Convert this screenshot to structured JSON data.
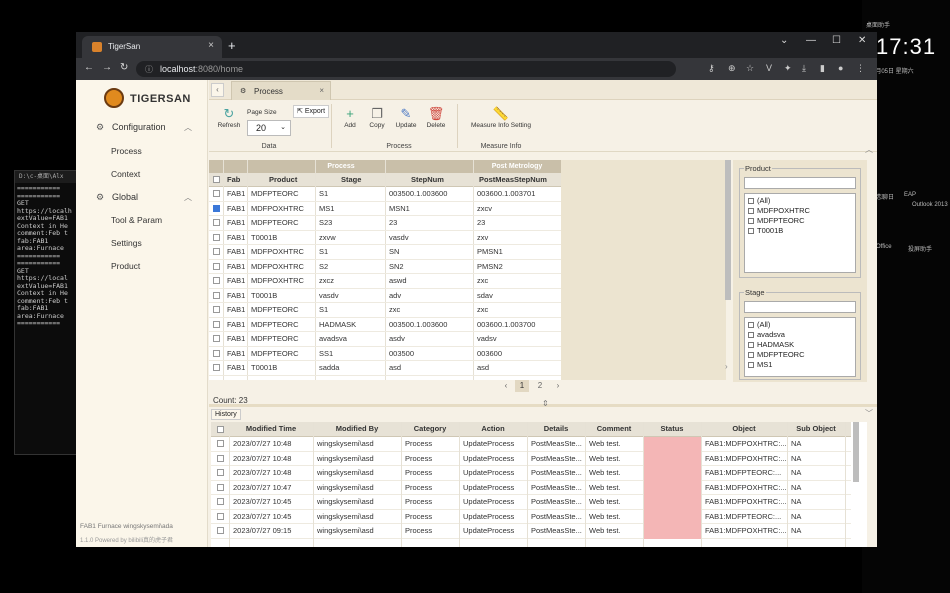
{
  "desktop": {
    "clock": "17:31",
    "widget_top": "桌面助手",
    "date_line": "7月05日  星期六",
    "icons": [
      "恋聊日",
      "EAP",
      "Outlook 2013",
      "Office",
      "投屏助手"
    ]
  },
  "console": {
    "title": "D:\\c-桌面\\Alx",
    "lines": [
      "===========",
      "",
      "===========",
      "GET",
      "https://localh",
      "extValue=FAB1",
      "",
      "Context in He",
      "comment:Feb t",
      "fab:FAB1",
      "area:Furnace",
      "",
      "===========",
      "",
      "===========",
      "GET",
      "https://local",
      "extValue=FAB1",
      "",
      "Context in He",
      "comment:Feb t",
      "fab:FAB1",
      "area:Furnace",
      "",
      "==========="
    ]
  },
  "browser": {
    "tab_title": "TigerSan",
    "url_host": "localhost",
    "url_path": ":8080/home"
  },
  "app": {
    "brand": "TIGERSAN",
    "nav": {
      "config_label": "Configuration",
      "config_items": [
        "Process",
        "Context"
      ],
      "global_label": "Global",
      "global_items": [
        "Tool & Param",
        "Settings",
        "Product"
      ]
    },
    "footer1": "FAB1  Furnace  wingskysemi\\ada",
    "footer2": "1.1.0  Powered by bilibili真的虎子君",
    "content_tab": "Process",
    "ribbon": {
      "refresh": "Refresh",
      "page_size_label": "Page Size",
      "page_size_value": "20",
      "export": "Export",
      "group_data": "Data",
      "add": "Add",
      "copy": "Copy",
      "update": "Update",
      "delete": "Delete",
      "group_process": "Process",
      "measure_setting": "Measure Info Setting",
      "group_measure": "Measure Info"
    },
    "grid": {
      "group_process": "Process",
      "group_post": "Post Metrology",
      "headers": [
        "Fab",
        "Product",
        "Stage",
        "StepNum",
        "PostMeasStepNum"
      ],
      "rows": [
        {
          "checked": false,
          "c": [
            "FAB1",
            "MDFPTEORC",
            "S1",
            "003500.1.003600",
            "003600.1.003701"
          ]
        },
        {
          "checked": true,
          "c": [
            "FAB1",
            "MDFPOXHTRC",
            "MS1",
            "MSN1",
            "zxcv"
          ]
        },
        {
          "checked": false,
          "c": [
            "FAB1",
            "MDFPTEORC",
            "S23",
            "23",
            "23"
          ]
        },
        {
          "checked": false,
          "c": [
            "FAB1",
            "T0001B",
            "zxvw",
            "vasdv",
            "zxv"
          ]
        },
        {
          "checked": false,
          "c": [
            "FAB1",
            "MDFPOXHTRC",
            "S1",
            "SN",
            "PMSN1"
          ]
        },
        {
          "checked": false,
          "c": [
            "FAB1",
            "MDFPOXHTRC",
            "S2",
            "SN2",
            "PMSN2"
          ]
        },
        {
          "checked": false,
          "c": [
            "FAB1",
            "MDFPOXHTRC",
            "zxcz",
            "aswd",
            "zxc"
          ]
        },
        {
          "checked": false,
          "c": [
            "FAB1",
            "T0001B",
            "vasdv",
            "adv",
            "sdav"
          ]
        },
        {
          "checked": false,
          "c": [
            "FAB1",
            "MDFPTEORC",
            "S1",
            "zxc",
            "zxc"
          ]
        },
        {
          "checked": false,
          "c": [
            "FAB1",
            "MDFPTEORC",
            "HADMASK",
            "003500.1.003600",
            "003600.1.003700"
          ]
        },
        {
          "checked": false,
          "c": [
            "FAB1",
            "MDFPTEORC",
            "avadsva",
            "asdv",
            "vadsv"
          ]
        },
        {
          "checked": false,
          "c": [
            "FAB1",
            "MDFPTEORC",
            "SS1",
            "003500",
            "003600"
          ]
        },
        {
          "checked": false,
          "c": [
            "FAB1",
            "T0001B",
            "sadda",
            "asd",
            "asd"
          ]
        }
      ],
      "pages": [
        "1",
        "2"
      ],
      "count": "Count: 23"
    },
    "filters": {
      "product_label": "Product",
      "product_options": [
        "(All)",
        "MDFPOXHTRC",
        "MDFPTEORC",
        "T0001B"
      ],
      "stage_label": "Stage",
      "stage_options": [
        "(All)",
        "avadsva",
        "HADMASK",
        "MDFPTEORC",
        "MS1"
      ]
    },
    "history": {
      "tab": "History",
      "headers": [
        "Modified Time",
        "Modified By",
        "Category",
        "Action",
        "Details",
        "Comment",
        "Status",
        "Object",
        "Sub Object"
      ],
      "rows": [
        [
          "2023/07/27 10:48",
          "wingskysemi\\asd",
          "Process",
          "UpdateProcess",
          "PostMeasSte...",
          "Web test.",
          "",
          "FAB1:MDFPOXHTRC:...",
          "NA"
        ],
        [
          "2023/07/27 10:48",
          "wingskysemi\\asd",
          "Process",
          "UpdateProcess",
          "PostMeasSte...",
          "Web test.",
          "",
          "FAB1:MDFPOXHTRC:...",
          "NA"
        ],
        [
          "2023/07/27 10:48",
          "wingskysemi\\asd",
          "Process",
          "UpdateProcess",
          "PostMeasSte...",
          "Web test.",
          "",
          "FAB1:MDFPTEORC:...",
          "NA"
        ],
        [
          "2023/07/27 10:47",
          "wingskysemi\\asd",
          "Process",
          "UpdateProcess",
          "PostMeasSte...",
          "Web test.",
          "",
          "FAB1:MDFPOXHTRC:...",
          "NA"
        ],
        [
          "2023/07/27 10:45",
          "wingskysemi\\asd",
          "Process",
          "UpdateProcess",
          "PostMeasSte...",
          "Web test.",
          "",
          "FAB1:MDFPOXHTRC:...",
          "NA"
        ],
        [
          "2023/07/27 10:45",
          "wingskysemi\\asd",
          "Process",
          "UpdateProcess",
          "PostMeasSte...",
          "Web test.",
          "",
          "FAB1:MDFPTEORC:...",
          "NA"
        ],
        [
          "2023/07/27 09:15",
          "wingskysemi\\asd",
          "Process",
          "UpdateProcess",
          "PostMeasSte...",
          "Web test.",
          "",
          "FAB1:MDFPOXHTRC:...",
          "NA"
        ]
      ]
    }
  }
}
